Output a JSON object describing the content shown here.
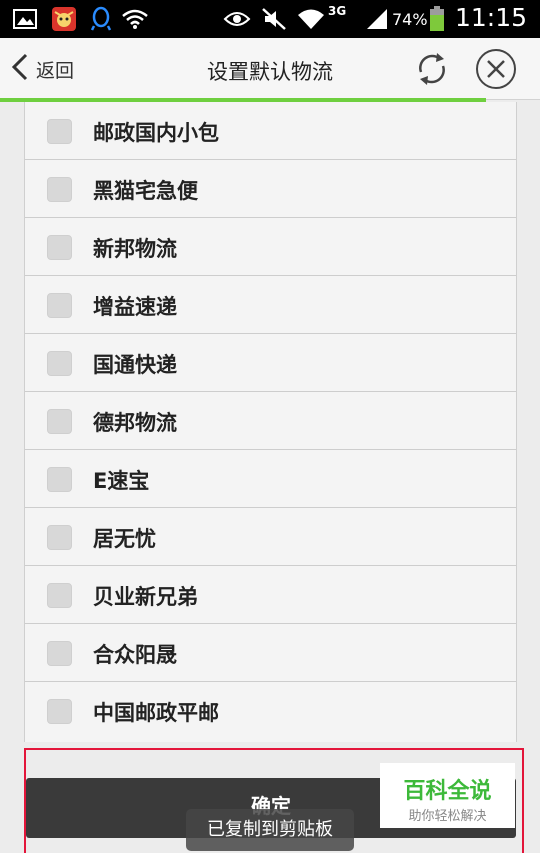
{
  "status_bar": {
    "battery_percent": "74%",
    "network": "3G",
    "time": "11:15"
  },
  "header": {
    "back_label": "返回",
    "title": "设置默认物流"
  },
  "page_load_progress": 0.9,
  "logistics_list": [
    {
      "label": "邮政国内小包",
      "checked": false
    },
    {
      "label": "黑猫宅急便",
      "checked": false
    },
    {
      "label": "新邦物流",
      "checked": false
    },
    {
      "label": "增益速递",
      "checked": false
    },
    {
      "label": "国通快递",
      "checked": false
    },
    {
      "label": "德邦物流",
      "checked": false
    },
    {
      "label": "E速宝",
      "checked": false
    },
    {
      "label": "居无忧",
      "checked": false
    },
    {
      "label": "贝业新兄弟",
      "checked": false
    },
    {
      "label": "合众阳晟",
      "checked": false
    },
    {
      "label": "中国邮政平邮",
      "checked": false
    }
  ],
  "confirm_label": "确定",
  "toast_text": "已复制到剪贴板",
  "watermark": {
    "title": "百科全说",
    "subtitle": "助你轻松解决"
  },
  "colors": {
    "accent_green": "#6fcf3f",
    "highlight_red": "#e3153a",
    "watermark_green": "#3db93a"
  }
}
